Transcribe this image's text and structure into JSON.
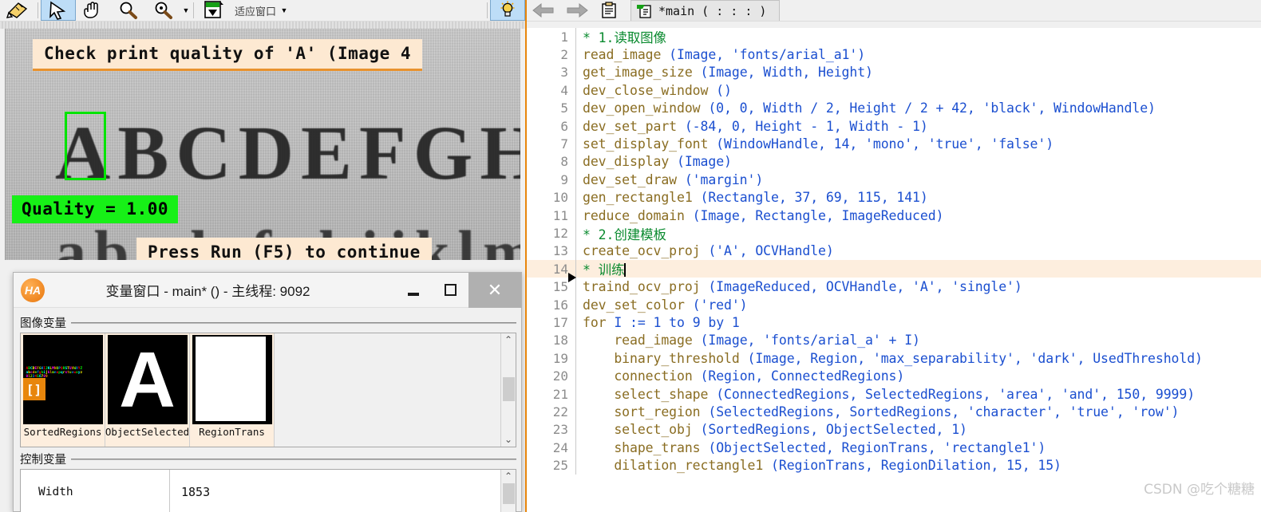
{
  "graphics_toolbar": {
    "buttons": [
      {
        "name": "draw-measure-tool",
        "icon": "pencil-ruler-icon",
        "selected": false
      },
      {
        "name": "select-arrow-tool",
        "icon": "cursor-arrow-icon",
        "selected": true
      },
      {
        "name": "pan-hand-tool",
        "icon": "hand-icon",
        "selected": false
      },
      {
        "name": "zoom-out-tool",
        "icon": "magnifier-icon",
        "selected": false
      },
      {
        "name": "zoom-in-tool",
        "icon": "magnifier-plus-icon",
        "selected": false
      }
    ],
    "fit_dropdown_label": "适应窗口",
    "lightbulb_icon": "lightbulb-icon"
  },
  "graphics_window": {
    "title_message": "Check print quality of 'A' (Image  4",
    "quality_message": "Quality = 1.00",
    "run_message": "Press Run (F5) to continue",
    "alphabet_upper": "ABCDEFGHIJKLMN",
    "alphabet_lower": "abcdefghijklmnop",
    "highlight_color": "#00e400",
    "quality_bg": "#17f017",
    "message_bg": "#fde9d2",
    "message_border": "#e8922e"
  },
  "variable_window": {
    "logo_text": "HA",
    "title": "变量窗口 - main* () - 主线程: 9092",
    "minimize_label": "—",
    "maximize_label": "□",
    "close_label": "✕",
    "image_group_label": "图像变量",
    "control_group_label": "控制变量",
    "image_variables": [
      {
        "name": "SortedRegions",
        "thumb": "color-alphabet-regions",
        "is_array": true,
        "array_badge": "[]"
      },
      {
        "name": "ObjectSelected",
        "thumb": "white-letter-A",
        "is_array": false,
        "letter": "A"
      },
      {
        "name": "RegionTrans",
        "thumb": "white-rectangle",
        "is_array": false
      }
    ],
    "control_variables": [
      {
        "name": "Width",
        "value": "1853"
      }
    ],
    "scroll_up_icon": "chevron-up-icon",
    "scroll_down_icon": "chevron-down-icon"
  },
  "editor": {
    "back_icon": "arrow-left-icon",
    "forward_icon": "arrow-right-icon",
    "procedures_icon": "procedure-list-icon",
    "tab_icon": "program-icon",
    "tab_label": "*main ( : : : )",
    "watermark": "CSDN @吃个糖糖",
    "current_line": 14,
    "lines": [
      {
        "n": "1",
        "text": "* 1.读取图像",
        "type": "comment"
      },
      {
        "n": "2",
        "text": "read_image (Image, 'fonts/arial_a1')",
        "type": "code"
      },
      {
        "n": "3",
        "text": "get_image_size (Image, Width, Height)",
        "type": "code"
      },
      {
        "n": "4",
        "text": "dev_close_window ()",
        "type": "code"
      },
      {
        "n": "5",
        "text": "dev_open_window (0, 0, Width / 2, Height / 2 + 42, 'black', WindowHandle)",
        "type": "code"
      },
      {
        "n": "6",
        "text": "dev_set_part (-84, 0, Height - 1, Width - 1)",
        "type": "code"
      },
      {
        "n": "7",
        "text": "set_display_font (WindowHandle, 14, 'mono', 'true', 'false')",
        "type": "code"
      },
      {
        "n": "8",
        "text": "dev_display (Image)",
        "type": "code"
      },
      {
        "n": "9",
        "text": "dev_set_draw ('margin')",
        "type": "code"
      },
      {
        "n": "10",
        "text": "gen_rectangle1 (Rectangle, 37, 69, 115, 141)",
        "type": "code"
      },
      {
        "n": "11",
        "text": "reduce_domain (Image, Rectangle, ImageReduced)",
        "type": "code"
      },
      {
        "n": "12",
        "text": "* 2.创建模板",
        "type": "comment"
      },
      {
        "n": "13",
        "text": "create_ocv_proj ('A', OCVHandle)",
        "type": "code"
      },
      {
        "n": "14",
        "text": "* 训练",
        "type": "comment",
        "highlight": true,
        "caret": true
      },
      {
        "n": "15",
        "text": "traind_ocv_proj (ImageReduced, OCVHandle, 'A', 'single')",
        "type": "code",
        "exec": true
      },
      {
        "n": "16",
        "text": "dev_set_color ('red')",
        "type": "code"
      },
      {
        "n": "17",
        "text": "for I := 1 to 9 by 1",
        "type": "code"
      },
      {
        "n": "18",
        "text": "    read_image (Image, 'fonts/arial_a' + I)",
        "type": "code"
      },
      {
        "n": "19",
        "text": "    binary_threshold (Image, Region, 'max_separability', 'dark', UsedThreshold)",
        "type": "code"
      },
      {
        "n": "20",
        "text": "    connection (Region, ConnectedRegions)",
        "type": "code"
      },
      {
        "n": "21",
        "text": "    select_shape (ConnectedRegions, SelectedRegions, 'area', 'and', 150, 9999)",
        "type": "code"
      },
      {
        "n": "22",
        "text": "    sort_region (SelectedRegions, SortedRegions, 'character', 'true', 'row')",
        "type": "code"
      },
      {
        "n": "23",
        "text": "    select_obj (SortedRegions, ObjectSelected, 1)",
        "type": "code"
      },
      {
        "n": "24",
        "text": "    shape_trans (ObjectSelected, RegionTrans, 'rectangle1')",
        "type": "code"
      },
      {
        "n": "25",
        "text": "    dilation_rectangle1 (RegionTrans, RegionDilation, 15, 15)",
        "type": "code"
      }
    ]
  }
}
